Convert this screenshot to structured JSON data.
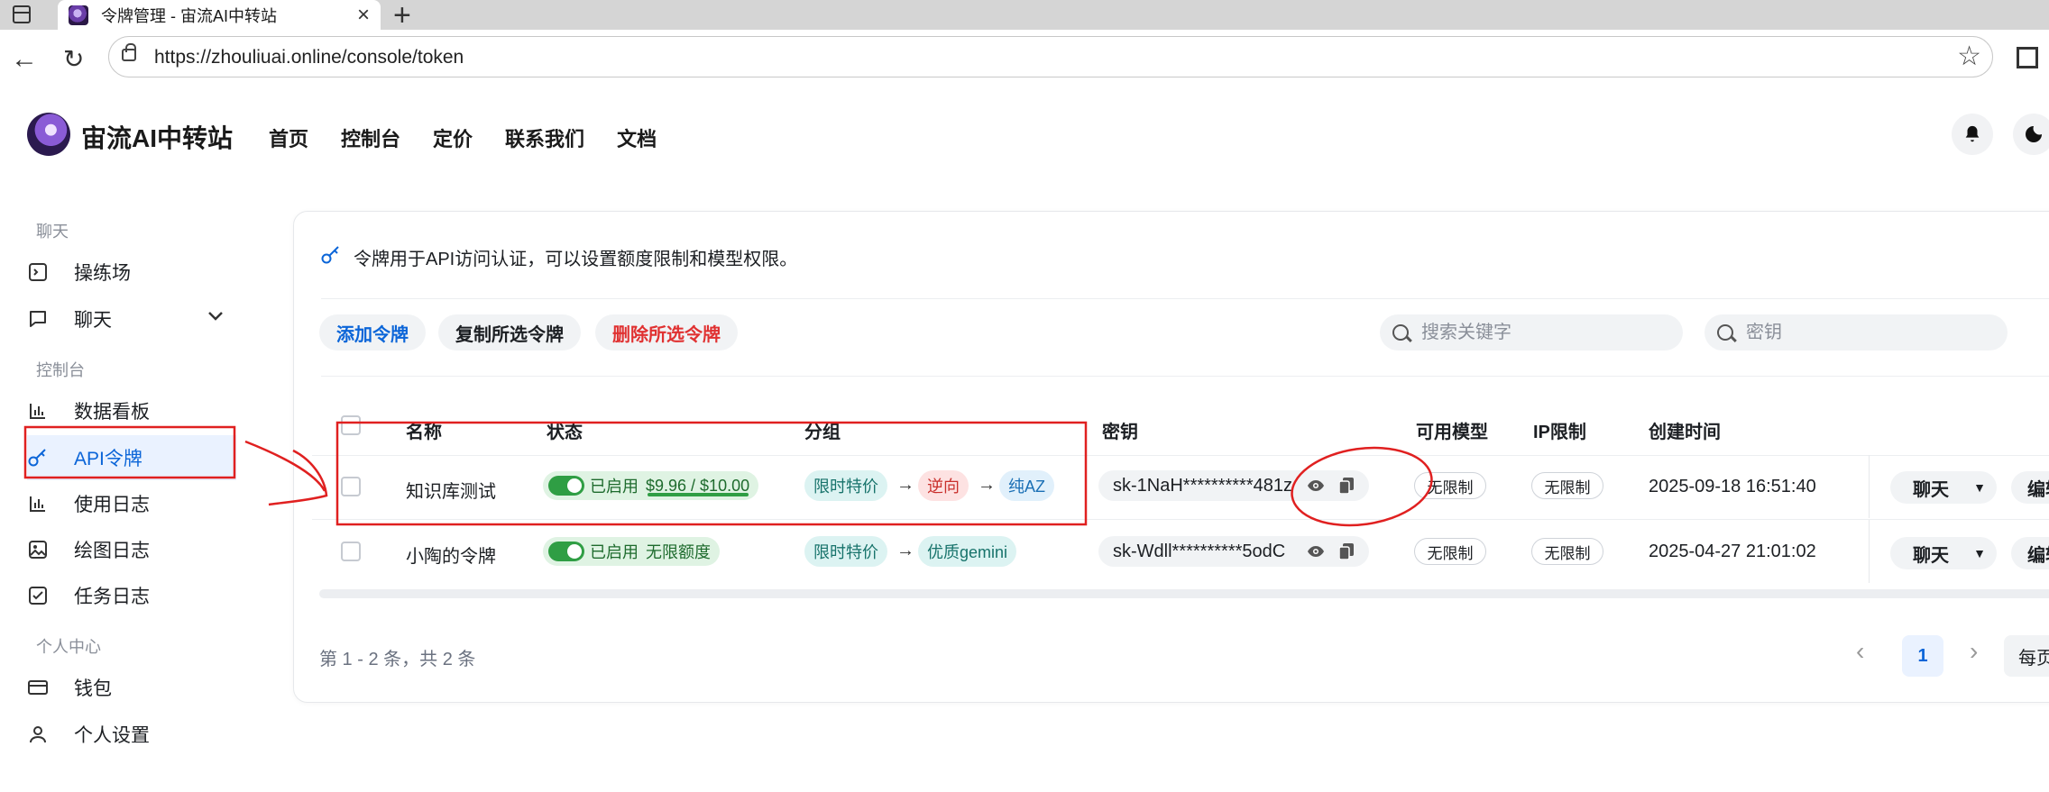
{
  "browser": {
    "tab_title": "令牌管理 - 宙流AI中转站",
    "url": "https://zhouliuai.online/console/token"
  },
  "header": {
    "brand": "宙流AI中转站",
    "nav": [
      "首页",
      "控制台",
      "定价",
      "联系我们",
      "文档"
    ]
  },
  "sidebar": {
    "groups": {
      "chat": "聊天",
      "console": "控制台",
      "personal": "个人中心"
    },
    "items": {
      "playground": "操练场",
      "chat": "聊天",
      "dashboard": "数据看板",
      "api_token": "API令牌",
      "usage_log": "使用日志",
      "drawing_log": "绘图日志",
      "task_log": "任务日志",
      "wallet": "钱包",
      "settings": "个人设置"
    },
    "active": "api_token"
  },
  "main": {
    "notice": "令牌用于API访问认证，可以设置额度限制和模型权限。",
    "actions": {
      "add": "添加令牌",
      "copy_selected": "复制所选令牌",
      "delete_selected": "删除所选令牌"
    },
    "search_keyword": {
      "placeholder": "搜索关键字"
    },
    "search_key": {
      "placeholder": "密钥"
    },
    "columns": {
      "name": "名称",
      "status": "状态",
      "group": "分组",
      "key": "密钥",
      "models": "可用模型",
      "ip_limit": "IP限制",
      "created": "创建时间"
    },
    "rows": [
      {
        "name": "知识库测试",
        "status": "已启用",
        "quota": "$9.96 / $10.00",
        "quota_remaining_fraction": 0.996,
        "groups": [
          "限时特价",
          "逆向",
          "纯AZ"
        ],
        "key": "sk-1NaH**********481z",
        "models": "无限制",
        "ip_limit": "无限制",
        "created": "2025-09-18 16:51:40",
        "chat": "聊天",
        "edit": "编辑"
      },
      {
        "name": "小陶的令牌",
        "status": "已启用",
        "quota": "无限额度",
        "groups": [
          "限时特价",
          "优质gemini"
        ],
        "key": "sk-Wdll**********5odC",
        "models": "无限制",
        "ip_limit": "无限制",
        "created": "2025-04-27 21:01:02",
        "chat": "聊天",
        "edit": "编辑"
      }
    ],
    "pagination": {
      "summary": "第 1 - 2 条，共 2 条",
      "current": "1",
      "page_size_label": "每页"
    }
  },
  "colors": {
    "accent": "#0b65d8",
    "danger": "#e03131",
    "success": "#2f9e44",
    "annotation": "#e02020"
  }
}
